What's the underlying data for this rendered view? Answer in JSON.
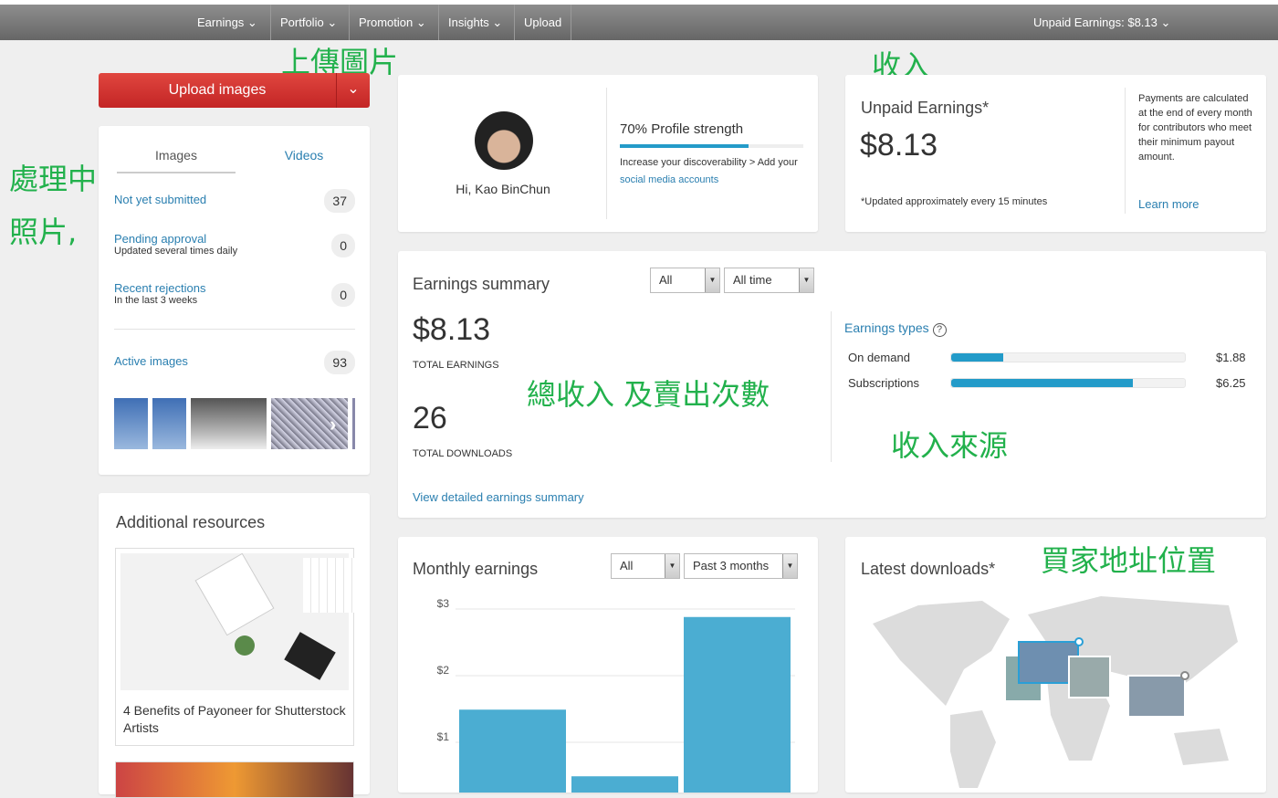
{
  "nav": {
    "items": [
      "Earnings",
      "Portfolio",
      "Promotion",
      "Insights",
      "Upload"
    ],
    "unpaid": "Unpaid Earnings: $8.13"
  },
  "annotations": {
    "upload": "上傳圖片",
    "income": "收入",
    "processing1": "處理中的",
    "processing2": "照片,",
    "total": "總收入 及賣出次數",
    "sources": "收入來源",
    "buyers": "買家地址位置"
  },
  "upload_button": {
    "label": "Upload images"
  },
  "portfolio": {
    "tabs": [
      "Images",
      "Videos"
    ],
    "rows": [
      {
        "label": "Not yet submitted",
        "sub": "",
        "count": "37"
      },
      {
        "label": "Pending approval",
        "sub": "Updated several times daily",
        "count": "0"
      },
      {
        "label": "Recent rejections",
        "sub": "In the last 3 weeks",
        "count": "0"
      }
    ],
    "active": {
      "label": "Active images",
      "count": "93"
    }
  },
  "resources": {
    "title": "Additional resources",
    "article": "4 Benefits of Payoneer for Shutterstock Artists"
  },
  "profile": {
    "greeting": "Hi, Kao BinChun",
    "strength": "70% Profile strength",
    "strength_pct": 70,
    "hint": "Increase your discoverability > Add your ",
    "hint_link": "social media accounts"
  },
  "unpaid": {
    "title": "Unpaid Earnings*",
    "amount": "$8.13",
    "note": "*Updated approximately every 15 minutes",
    "info": "Payments are calculated at the end of every month for contributors who meet their minimum payout amount.",
    "learn": "Learn more"
  },
  "summary": {
    "title": "Earnings summary",
    "filter1": "All",
    "filter2": "All time",
    "total": "$8.13",
    "total_label": "TOTAL EARNINGS",
    "downloads": "26",
    "downloads_label": "TOTAL DOWNLOADS",
    "link": "View detailed earnings summary",
    "types_title": "Earnings types",
    "types": [
      {
        "label": "On demand",
        "value": "$1.88",
        "amount": 1.88
      },
      {
        "label": "Subscriptions",
        "value": "$6.25",
        "amount": 6.25
      }
    ]
  },
  "monthly": {
    "title": "Monthly earnings",
    "filter1": "All",
    "filter2": "Past 3 months"
  },
  "latest": {
    "title": "Latest downloads*"
  },
  "chart_data": {
    "type": "bar",
    "values": [
      1.49,
      0.49,
      2.88
    ],
    "yticks": [
      "$1",
      "$2",
      "$3"
    ],
    "ylim": [
      0,
      3.2
    ],
    "grid": true,
    "color": "#4badd2"
  }
}
